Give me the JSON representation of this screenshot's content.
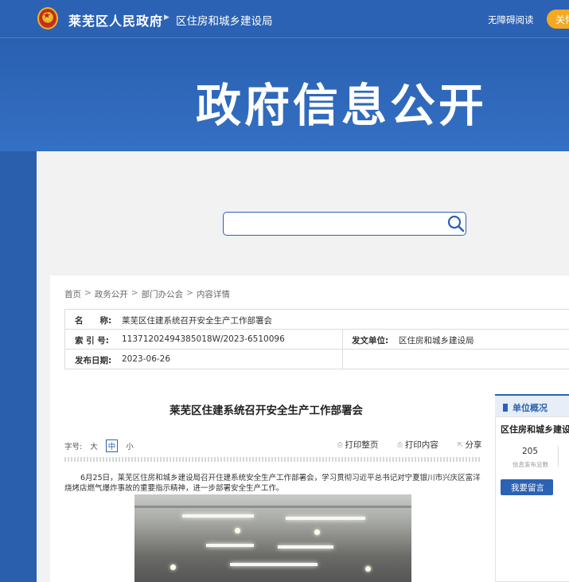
{
  "header": {
    "site_name": "莱芜区人民政府",
    "dept_name": "区住房和城乡建设局",
    "accessibility_label": "无障碍阅读",
    "care_label": "关怀"
  },
  "banner": {
    "title": "政府信息公开"
  },
  "search": {
    "placeholder": ""
  },
  "breadcrumb": [
    "首页",
    "政务公开",
    "部门办公会",
    "内容详情"
  ],
  "meta": {
    "name_label": "名　　称:",
    "name_value": "莱芜区住建系统召开安全生产工作部署会",
    "index_label": "索 引 号:",
    "index_value": "11371202494385018W/2023-6510096",
    "issuer_label": "发文单位:",
    "issuer_value": "区住房和城乡建设局",
    "date_label": "发布日期:",
    "date_value": "2023-06-26"
  },
  "article": {
    "title": "莱芜区住建系统召开安全生产工作部署会",
    "font_size_label": "字号:",
    "font_sizes": [
      "大",
      "中",
      "小"
    ],
    "tools": {
      "print_page": "打印整页",
      "print_content": "打印内容",
      "share": "分享"
    },
    "paragraph": "6月25日，莱芜区住房和城乡建设局召开住建系统安全生产工作部署会，学习贯彻习近平总书记对宁夏银川市兴庆区富洋烧烤店燃气爆炸事故的重要指示精神，进一步部署安全生产工作。"
  },
  "sidebar": {
    "title": "单位概况",
    "org_name": "区住房和城乡建设局",
    "count_value": "205",
    "count_label": "信息发布总数",
    "message_button": "我要留言"
  },
  "colors": {
    "primary": "#2b62b3",
    "accent": "#f4a922"
  }
}
